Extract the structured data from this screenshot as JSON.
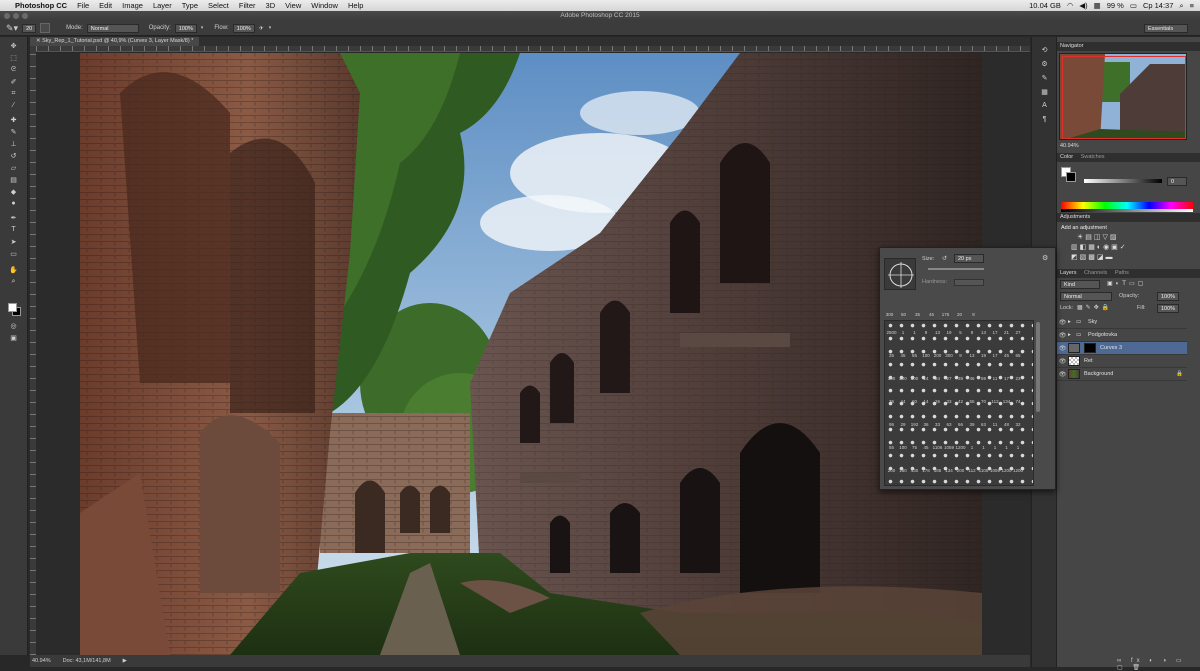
{
  "menubar": {
    "app_name": "Photoshop CC",
    "items": [
      "File",
      "Edit",
      "Image",
      "Layer",
      "Type",
      "Select",
      "Filter",
      "3D",
      "View",
      "Window",
      "Help"
    ],
    "right_text": [
      "10.04 GB",
      "99 %",
      "Ср 14:37"
    ]
  },
  "window": {
    "title": "Adobe Photoshop CC 2015"
  },
  "options_bar": {
    "brush_size": "20",
    "mode_label": "Mode:",
    "mode_value": "Normal",
    "opacity_label": "Opacity:",
    "opacity_value": "100%",
    "flow_label": "Flow:",
    "flow_value": "100%",
    "workspace": "Essentials"
  },
  "document": {
    "tab_title": "Sky_Rep_1_Tutorial.psd @ 40,9% (Curves 3, Layer Mask/8) *",
    "zoom": "40.94%",
    "doc_size": "Doc: 43,1M/141,8M"
  },
  "brush_picker": {
    "size_label": "Size:",
    "size_value": "20 px",
    "hardness_label": "Hardness:",
    "top_row": [
      "300",
      "50",
      "35",
      "45",
      "175",
      "20",
      "8"
    ],
    "grid_numbers": [
      [
        "2500",
        "1",
        "1",
        "9",
        "13",
        "19",
        "5",
        "9",
        "13",
        "17",
        "21",
        "27"
      ],
      [
        "35",
        "45",
        "65",
        "100",
        "200",
        "300",
        "9",
        "13",
        "19",
        "17",
        "45",
        "65"
      ],
      [
        "100",
        "200",
        "300",
        "14",
        "24",
        "27",
        "39",
        "46",
        "59",
        "11",
        "17",
        "23"
      ],
      [
        "36",
        "44",
        "60",
        "14",
        "26",
        "33",
        "42",
        "55",
        "70",
        "112",
        "134",
        "74"
      ],
      [
        "95",
        "29",
        "192",
        "36",
        "33",
        "63",
        "66",
        "39",
        "63",
        "11",
        "48",
        "32"
      ],
      [
        "55",
        "100",
        "75",
        "45",
        "1106",
        "1059",
        "1200",
        "1",
        "1",
        "1",
        "1",
        "1"
      ],
      [
        "200",
        "160",
        "430",
        "178",
        "185",
        "134",
        "200",
        "112",
        "1106",
        "1059",
        "1200",
        "1200"
      ]
    ]
  },
  "panels": {
    "navigator_tab": "Navigator",
    "navigator_zoom": "40.94%",
    "color_tab": "Color",
    "swatches_tab": "Swatches",
    "color_k_value": "0",
    "adjustments_tab": "Adjustments",
    "add_adjustment": "Add an adjustment",
    "layers_tabs": [
      "Layers",
      "Channels",
      "Paths"
    ],
    "kind_label": "Kind",
    "blend_mode": "Normal",
    "opacity_label": "Opacity:",
    "opacity_value": "100%",
    "lock_label": "Lock:",
    "fill_label": "Fill:",
    "fill_value": "100%",
    "layers": [
      {
        "name": "Sky",
        "type": "group"
      },
      {
        "name": "Podgotovka",
        "type": "group"
      },
      {
        "name": "Curves 3",
        "type": "adjustment",
        "selected": true
      },
      {
        "name": "Ret",
        "type": "pixel"
      },
      {
        "name": "Background",
        "type": "pixel",
        "locked": true
      }
    ]
  },
  "tools": [
    "move-icon",
    "marquee-icon",
    "lasso-icon",
    "quick-select-icon",
    "crop-icon",
    "eyedropper-icon",
    "healing-icon",
    "brush-icon",
    "clone-stamp-icon",
    "history-brush-icon",
    "eraser-icon",
    "gradient-icon",
    "blur-icon",
    "dodge-icon",
    "pen-icon",
    "type-icon",
    "path-select-icon",
    "shape-icon",
    "hand-icon",
    "zoom-icon"
  ]
}
